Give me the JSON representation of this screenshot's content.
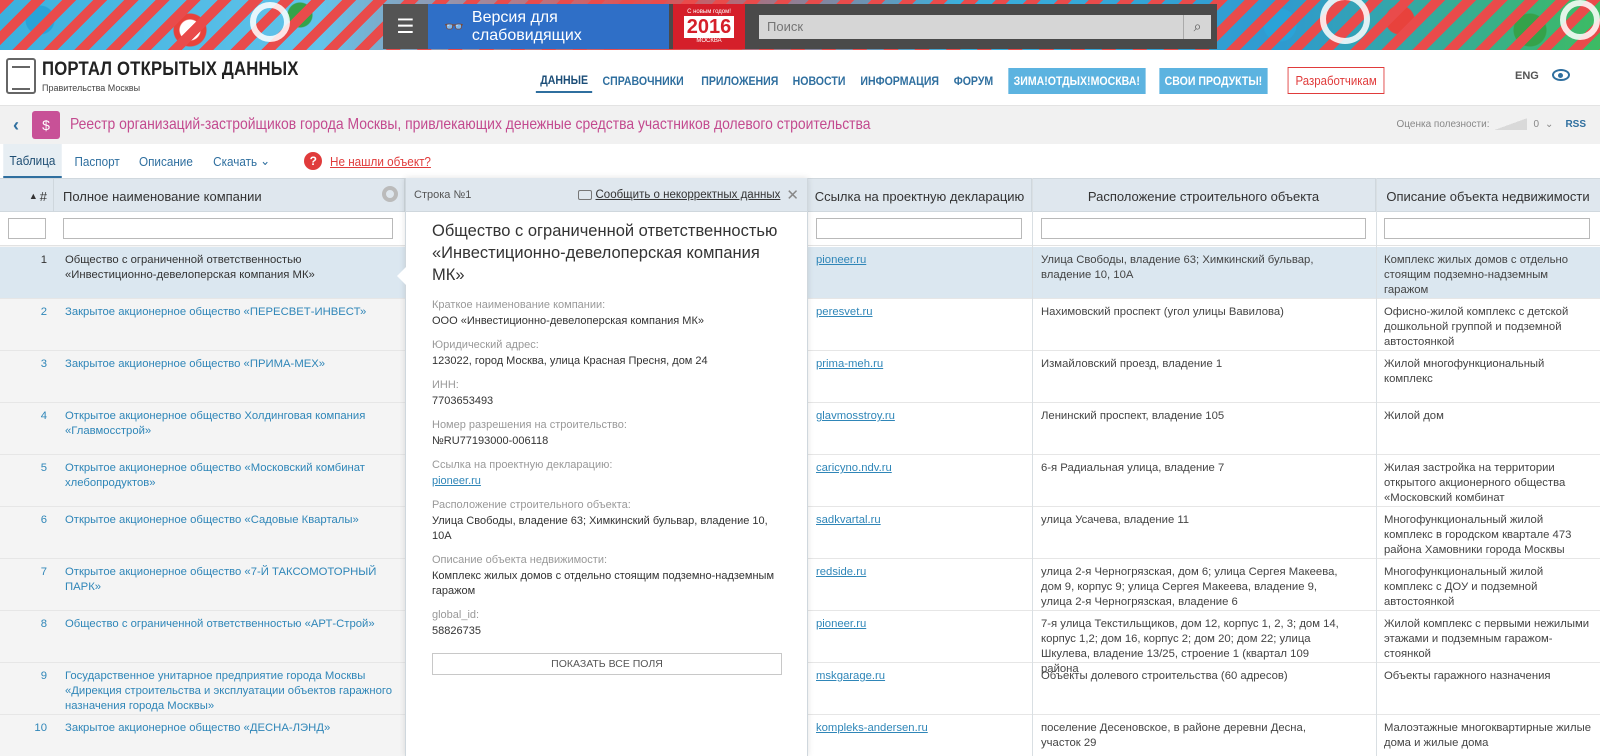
{
  "banner": {
    "vision_label": "Версия для слабовидящих",
    "badge_top": "С новым годом!",
    "badge_year": "2016",
    "badge_city": "МОСКВА",
    "search_placeholder": "Поиск"
  },
  "header": {
    "logo_title": "ПОРТАЛ ОТКРЫТЫХ ДАННЫХ",
    "logo_subtitle": "Правительства Москвы",
    "nav": [
      "ДАННЫЕ",
      "СПРАВОЧНИКИ",
      "ПРИЛОЖЕНИЯ",
      "НОВОСТИ",
      "ИНФОРМАЦИЯ",
      "ФОРУМ",
      "ЗИМА!ОТДЫХ!МОСКВА!",
      "СВОИ ПРОДУКТЫ!",
      "Разработчикам"
    ],
    "lang": "ENG"
  },
  "dataset": {
    "title": "Реестр организаций-застройщиков города Москвы, привлекающих денежные средства участников долевого строительства",
    "rating_label": "Оценка полезности:",
    "rating_value": "0",
    "rss": "RSS"
  },
  "tabs": [
    "Таблица",
    "Паспорт",
    "Описание",
    "Скачать"
  ],
  "not_found": "Не нашли объект?",
  "table": {
    "headers": {
      "num": "#",
      "name": "Полное наименование компании",
      "link": "Ссылка на проектную декларацию",
      "location": "Расположение строительного объекта",
      "description": "Описание объекта недвижимости"
    },
    "rows": [
      {
        "num": "1",
        "name": "Общество с ограниченной ответственностью «Инвестиционно-девелоперская компания МК»",
        "link": "pioneer.ru",
        "location": "Улица Свободы, владение 63; Химкинский бульвар, владение 10, 10А",
        "description": "Комплекс жилых домов с отдельно стоящим подземно-надземным гаражом"
      },
      {
        "num": "2",
        "name": "Закрытое акционерное общество «ПЕРЕСВЕТ-ИНВЕСТ»",
        "link": "peresvet.ru",
        "location": "Нахимовский проспект (угол улицы Вавилова)",
        "description": "Офисно-жилой комплекс с детской дошкольной группой и подземной автостоянкой"
      },
      {
        "num": "3",
        "name": "Закрытое акционерное общество «ПРИМА-МЕХ»",
        "link": "prima-meh.ru",
        "location": "Измайловский проезд, владение 1",
        "description": "Жилой многофункциональный комплекс"
      },
      {
        "num": "4",
        "name": "Открытое акционерное общество Холдинговая компания «Главмосстрой»",
        "link": "glavmosstroy.ru",
        "location": "Ленинский проспект, владение 105",
        "description": "Жилой дом"
      },
      {
        "num": "5",
        "name": "Открытое акционерное общество «Московский комбинат хлебопродуктов»",
        "link": "caricyno.ndv.ru",
        "location": "6-я Радиальная улица, владение 7",
        "description": "Жилая застройка на территории открытого акционерного общества «Московский комбинат"
      },
      {
        "num": "6",
        "name": "Открытое акционерное общество «Садовые Кварталы»",
        "link": "sadkvartal.ru",
        "location": "улица Усачева, владение 11",
        "description": "Многофункциональный жилой комплекс в городском квартале 473 района Хамовники города Москвы"
      },
      {
        "num": "7",
        "name": "Открытое акционерное общество «7-Й ТАКСОМОТОРНЫЙ ПАРК»",
        "link": "redside.ru",
        "location": "улица 2-я Черногрязская, дом 6; улица Сергея Макеева, дом 9, корпус 9; улица Сергея Макеева, владение 9, улица 2-я Черногрязская, владение 6",
        "description": "Многофункциональный жилой комплекс с ДОУ и подземной автостоянкой"
      },
      {
        "num": "8",
        "name": "Общество с ограниченной ответственностью «АРТ-Строй»",
        "link": "pioneer.ru",
        "location": "7-я улица Текстильщиков, дом 12, корпус 1, 2, 3; дом 14, корпус 1,2; дом 16, корпус 2; дом 20; дом 22; улица Шкулева, владение 13/25, строение 1 (квартал 109 района",
        "description": "Жилой комплекс с первыми нежилыми этажами и подземным гаражом-стоянкой"
      },
      {
        "num": "9",
        "name": "Государственное унитарное предприятие города Москвы «Дирекция строительства и эксплуатации объектов гаражного назначения города Москвы»",
        "link": "mskgarage.ru",
        "location": "Объекты долевого строительства (60 адресов)",
        "description": "Объекты гаражного назначения"
      },
      {
        "num": "10",
        "name": "Закрытое акционерное общество «ДЕСНА-ЛЭНД»",
        "link": "kompleks-andersen.ru",
        "location": "поселение Десеновское, в районе деревни Десна, участок 29",
        "description": "Малоэтажные многоквартирные жилые дома и жилые дома"
      }
    ]
  },
  "detail": {
    "row_label": "Строка №1",
    "report_label": "Сообщить о некорректных данных",
    "title": "Общество с ограниченной ответственностью «Инвестиционно-девелоперская компания МК»",
    "fields": [
      {
        "label": "Краткое наименование компании:",
        "value": "ООО «Инвестиционно-девелоперская компания МК»"
      },
      {
        "label": "Юридический адрес:",
        "value": "123022, город Москва, улица Красная Пресня, дом 24"
      },
      {
        "label": "ИНН:",
        "value": "7703653493"
      },
      {
        "label": "Номер разрешения на строительство:",
        "value": "№RU77193000-006118"
      },
      {
        "label": "Ссылка на проектную декларацию:",
        "value": "pioneer.ru",
        "link": true
      },
      {
        "label": "Расположение строительного объекта:",
        "value": "Улица Свободы, владение 63; Химкинский бульвар, владение 10, 10А"
      },
      {
        "label": "Описание объекта недвижимости:",
        "value": "Комплекс жилых домов с отдельно стоящим подземно-надземным гаражом"
      },
      {
        "label": "global_id:",
        "value": "58826735"
      }
    ],
    "show_all": "ПОКАЗАТЬ ВСЕ ПОЛЯ"
  }
}
